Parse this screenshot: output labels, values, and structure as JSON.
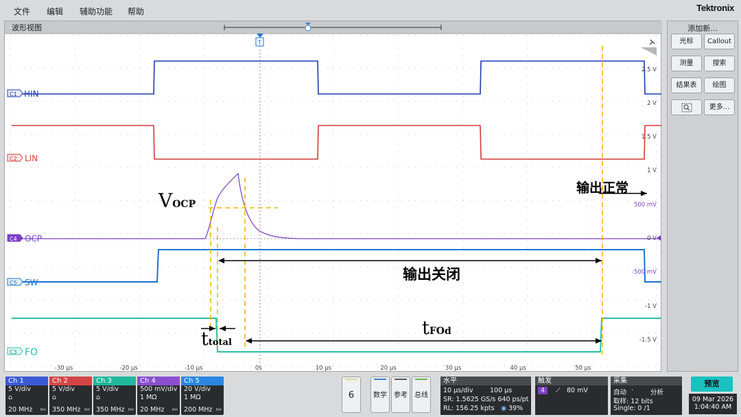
{
  "menu": {
    "file": "文件",
    "edit": "编辑",
    "utility": "辅助功能",
    "help": "帮助",
    "brand": "Tektronix"
  },
  "waveform_view": {
    "title": "波形视图",
    "trigger_marker": "T",
    "channels": [
      {
        "id": "c1",
        "badge": "C1",
        "name": "HIN",
        "color": "#1f3bb3"
      },
      {
        "id": "c2",
        "badge": "C2",
        "name": "LIN",
        "color": "#d63a3a"
      },
      {
        "id": "c4",
        "badge": "C4",
        "name": "OCP",
        "color": "#7b3fc4"
      },
      {
        "id": "c5",
        "badge": "C5",
        "name": "SW",
        "color": "#1b74d3"
      },
      {
        "id": "c3",
        "badge": "C3",
        "name": "FO",
        "color": "#22c2a8"
      }
    ],
    "right_scale": [
      "2.5 V",
      "2 V",
      "1.5 V",
      "1 V",
      "500 mV",
      "0 V",
      "-500 mV",
      "-1 V",
      "-1.5 V"
    ],
    "time_ticks": [
      "-30 μs",
      "-20 μs",
      "-10 μs",
      "0s",
      "10 μs",
      "20 μs",
      "30 μs",
      "40 μs",
      "50 μs"
    ],
    "annotations": {
      "vocp_main": "V",
      "vocp_sub": "OCP",
      "output_normal": "输出正常",
      "output_off": "输出关闭",
      "ttotal_main": "t",
      "ttotal_sub": "total",
      "tfod_main": "t",
      "tfod_sub": "FOd"
    }
  },
  "right_panel": {
    "title": "添加新...",
    "buttons": {
      "cursor": "光标",
      "callout": "Callout",
      "measure": "测量",
      "search": "搜索",
      "results": "结果表",
      "plot": "绘图",
      "more": "更多..."
    }
  },
  "bottom_bar": {
    "channels": [
      {
        "head": "Ch 1",
        "scale": "5 V/div",
        "bw": "20 MHz",
        "color": "#3b5bd6"
      },
      {
        "head": "Ch 2",
        "scale": "5 V/div",
        "bw": "350 MHz",
        "color": "#d64545"
      },
      {
        "head": "Ch 3",
        "scale": "5 V/div",
        "bw": "350 MHz",
        "color": "#21b89e"
      },
      {
        "head": "Ch 4",
        "scale": "500 mV/div",
        "imp": "1 MΩ",
        "bw": "20 MHz",
        "color": "#8a4fd0"
      },
      {
        "head": "Ch 5",
        "scale": "20 V/div",
        "imp": "1 MΩ",
        "bw": "200 MHz",
        "color": "#2a86e0"
      }
    ],
    "math_count": "6",
    "math_label": "数学",
    "ref_label": "参考",
    "bus_label": "总线",
    "horizontal": {
      "head": "水平",
      "scale": "10 μs/div",
      "record": "100 μs",
      "sr": "SR: 1.5625 GS/s 640 ps/pt",
      "rl": "RL: 156.25 kpts",
      "pos": "39%"
    },
    "trigger": {
      "head": "触发",
      "source": "4",
      "level": "80 mV"
    },
    "acquisition": {
      "head": "采集",
      "mode": "自动",
      "analyze": "分析",
      "sample": "取样: 12 bits",
      "single": "Single: 0 /1"
    },
    "preview": "预览",
    "date": "09 Mar 2026",
    "time": "1:04:40 AM"
  }
}
